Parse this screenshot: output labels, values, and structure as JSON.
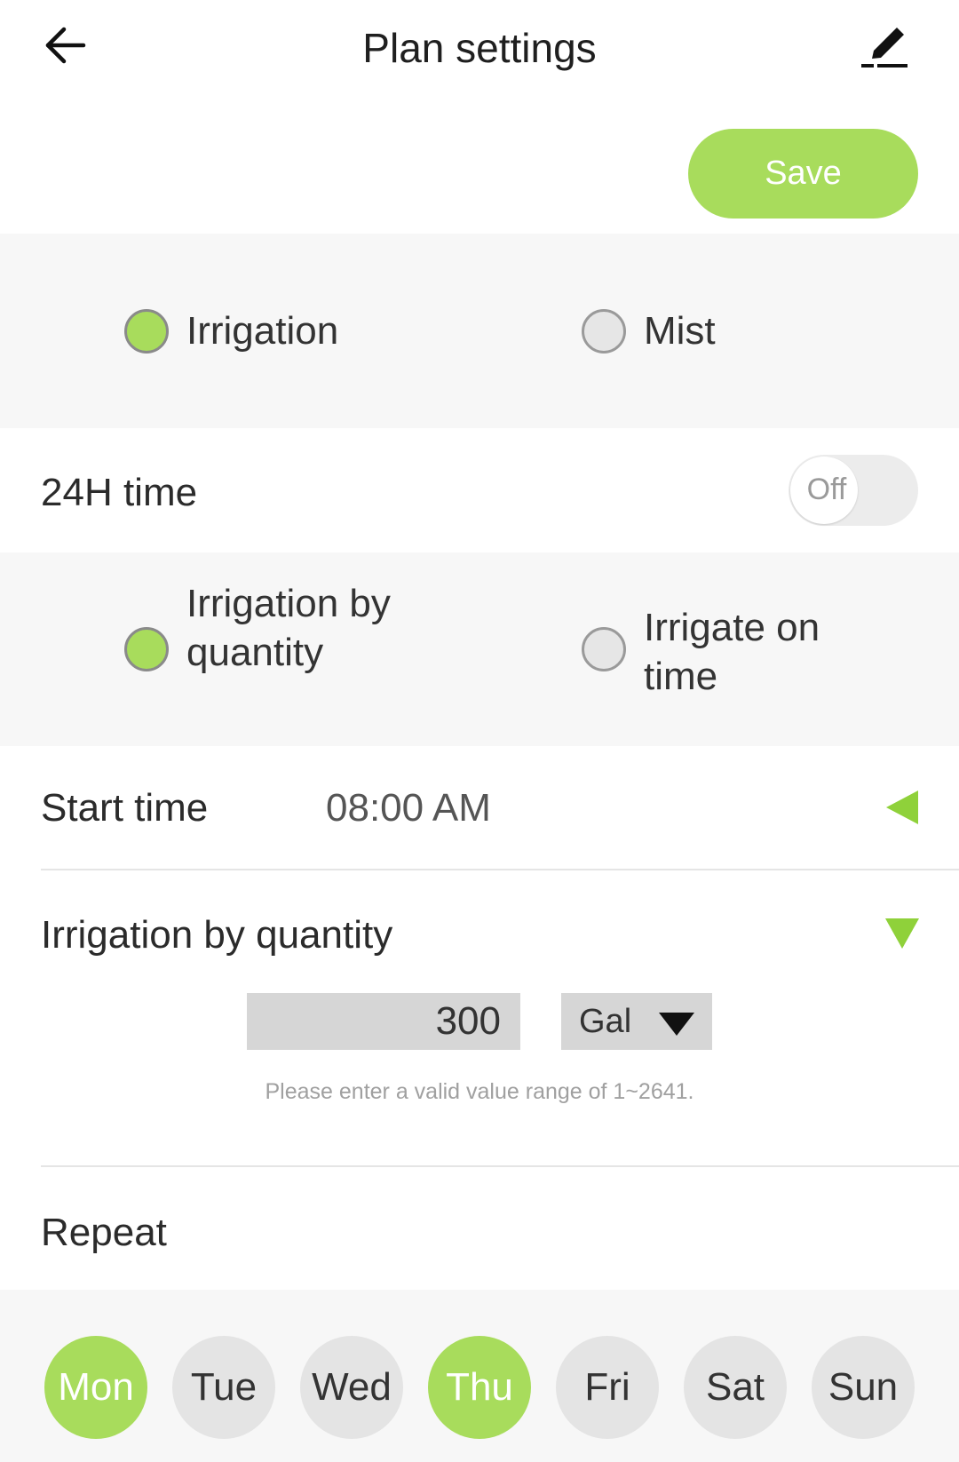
{
  "header": {
    "title": "Plan settings",
    "back_icon": "back-arrow-icon",
    "edit_icon": "edit-pencil-icon"
  },
  "save_label": "Save",
  "mode": {
    "options": [
      {
        "label": "Irrigation",
        "selected": true
      },
      {
        "label": "Mist",
        "selected": false
      }
    ]
  },
  "time_format": {
    "label": "24H time",
    "toggle_text": "Off",
    "enabled": false
  },
  "method": {
    "options": [
      {
        "label": "Irrigation by quantity",
        "selected": true
      },
      {
        "label": "Irrigate on time",
        "selected": false
      }
    ]
  },
  "start_time": {
    "label": "Start time",
    "value": "08:00 AM"
  },
  "quantity": {
    "label": "Irrigation by quantity",
    "value": "300",
    "unit": "Gal",
    "hint": "Please enter a valid value range of 1~2641."
  },
  "repeat": {
    "label": "Repeat",
    "days": [
      {
        "label": "Mon",
        "selected": true
      },
      {
        "label": "Tue",
        "selected": false
      },
      {
        "label": "Wed",
        "selected": false
      },
      {
        "label": "Thu",
        "selected": true
      },
      {
        "label": "Fri",
        "selected": false
      },
      {
        "label": "Sat",
        "selected": false
      },
      {
        "label": "Sun",
        "selected": false
      }
    ]
  },
  "colors": {
    "accent": "#a8dc5c",
    "band_background": "#f7f7f7",
    "day_off": "#e4e4e4"
  }
}
